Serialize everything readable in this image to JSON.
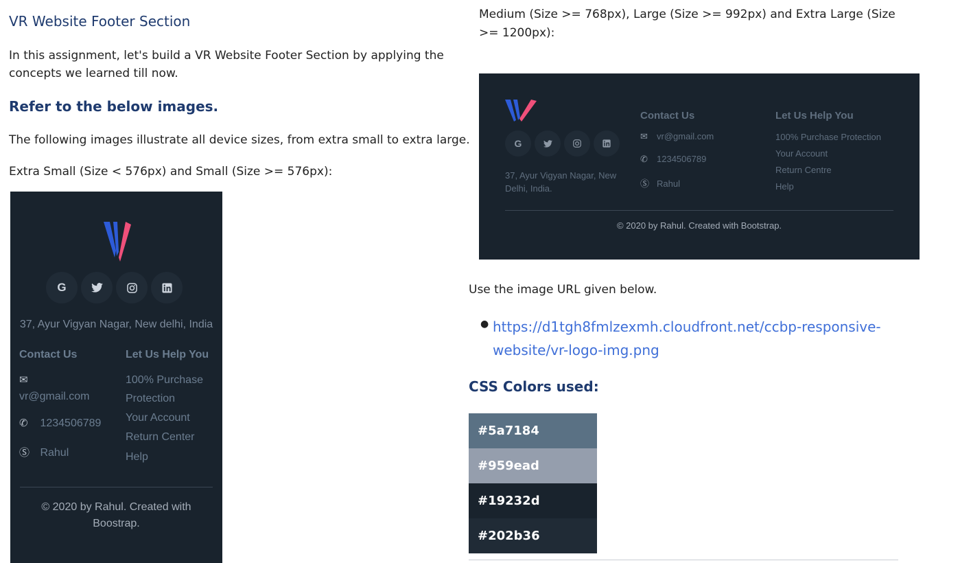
{
  "left": {
    "title": "VR Website Footer Section",
    "intro": "In this assignment, let's build a VR Website Footer Section by applying the concepts we learned till now.",
    "refer_heading": "Refer to the below images.",
    "following": "The following images illustrate all device sizes, from extra small to extra large.",
    "xs_label": "Extra Small (Size < 576px) and Small (Size >= 576px):"
  },
  "mobile_footer": {
    "address": "37, Ayur Vigyan Nagar, New delhi, India",
    "contact_heading": "Contact Us",
    "help_heading": "Let Us Help You",
    "email": "vr@gmail.com",
    "phone": "1234506789",
    "skype": "Rahul",
    "help_items": [
      "100% Purchase",
      "Protection",
      "Your Account",
      "Return Center",
      "Help"
    ],
    "copyright": "© 2020 by Rahul. Created with Boostrap."
  },
  "right": {
    "md_label": "Medium (Size >= 768px), Large (Size >= 992px) and Extra Large (Size >= 1200px):",
    "use_image": "Use the image URL given below.",
    "link": "https://d1tgh8fmlzexmh.cloudfront.net/ccbp-responsive-website/vr-logo-img.png",
    "colors_heading": "CSS Colors used:"
  },
  "desktop_footer": {
    "address": "37, Ayur Vigyan Nagar, New Delhi, India.",
    "contact_heading": "Contact Us",
    "help_heading": "Let Us Help You",
    "email": "vr@gmail.com",
    "phone": "1234506789",
    "skype": "Rahul",
    "help_items": [
      "100% Purchase Protection",
      "Your Account",
      "Return Centre",
      "Help"
    ],
    "copyright": "© 2020 by Rahul. Created with Bootstrap."
  },
  "social_icons": [
    "google-icon",
    "twitter-icon",
    "instagram-icon",
    "linkedin-icon"
  ],
  "colors": [
    {
      "hex": "#5a7184",
      "label": "#5a7184"
    },
    {
      "hex": "#959ead",
      "label": "#959ead"
    },
    {
      "hex": "#19232d",
      "label": "#19232d"
    },
    {
      "hex": "#202b36",
      "label": "#202b36"
    }
  ]
}
